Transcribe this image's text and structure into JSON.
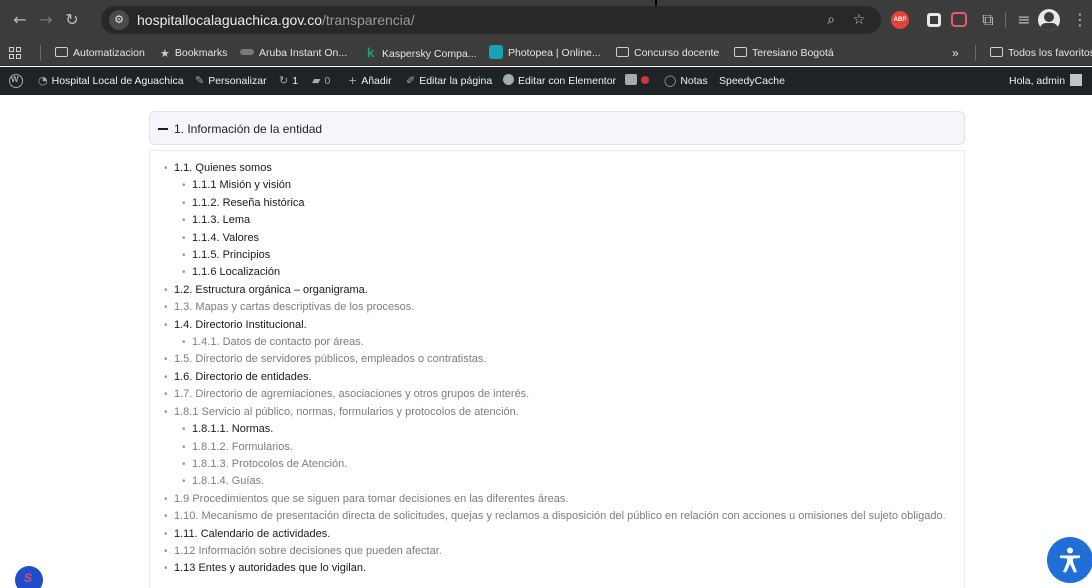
{
  "browser": {
    "url_host": "hospitallocalaguachica.gov.co",
    "url_path": "/transparencia/",
    "nav_icons": [
      "back-arrow-icon",
      "forward-arrow-icon",
      "reload-icon"
    ],
    "extension_abp_label": "ABP"
  },
  "bookmarks": {
    "items": [
      {
        "label": "Automatizacion",
        "icon": "folder-icon"
      },
      {
        "label": "Bookmarks",
        "icon": "star-icon"
      },
      {
        "label": "Aruba Instant On...",
        "icon": "aruba-icon"
      },
      {
        "label": "Kaspersky Compa...",
        "icon": "kaspersky-icon"
      },
      {
        "label": "Photopea | Online...",
        "icon": "photopea-icon"
      },
      {
        "label": "Concurso docente",
        "icon": "folder-icon"
      },
      {
        "label": "Teresiano Bogotá",
        "icon": "folder-icon"
      }
    ],
    "overflow": "»",
    "all_bookmarks": "Todos los favoritos"
  },
  "admin_bar": {
    "site_name": "Hospital Local de Aguachica",
    "customize": "Personalizar",
    "updates_count": "1",
    "comments_count": "0",
    "add_new": "Añadir",
    "edit_page": "Editar la página",
    "edit_elementor": "Editar con Elementor",
    "notes": "Notas",
    "speedycache": "SpeedyCache",
    "greeting": "Hola, admin"
  },
  "accordion": {
    "title": "1. Información de la entidad",
    "items": [
      {
        "text": "1.1. Quienes somos",
        "level": 1,
        "style": "dark"
      },
      {
        "text": "1.1.1 Misión y visión",
        "level": 2,
        "style": "dark"
      },
      {
        "text": "1.1.2. Reseña histórica",
        "level": 2,
        "style": "dark"
      },
      {
        "text": "1.1.3. Lema",
        "level": 2,
        "style": "dark"
      },
      {
        "text": "1.1.4. Valores",
        "level": 2,
        "style": "dark"
      },
      {
        "text": "1.1.5. Principios",
        "level": 2,
        "style": "dark"
      },
      {
        "text": "1.1.6 Localización",
        "level": 2,
        "style": "dark"
      },
      {
        "text": "1.2. Estructura orgánica – organigrama.",
        "level": 1,
        "style": "dark"
      },
      {
        "text": "1.3. Mapas y cartas descriptivas de los procesos.",
        "level": 1,
        "style": "grey"
      },
      {
        "text": "1.4. Directorio Institucional.",
        "level": 1,
        "style": "dark"
      },
      {
        "text": "1.4.1. Datos de contacto por áreas.",
        "level": 2,
        "style": "grey"
      },
      {
        "text": "1.5. Directorio de servidores públicos, empleados o contratistas.",
        "level": 1,
        "style": "grey"
      },
      {
        "text": "1.6. Directorio de entidades.",
        "level": 1,
        "style": "dark"
      },
      {
        "text": "1.7. Directorio de agremiaciones, asociaciones y otros grupos de interés.",
        "level": 1,
        "style": "grey"
      },
      {
        "text": "1.8.1 Servicio al público, normas, formularios y protocolos de atención.",
        "level": 1,
        "style": "grey"
      },
      {
        "text": "1.8.1.1. Normas.",
        "level": 2,
        "style": "dark"
      },
      {
        "text": "1.8.1.2. Formularios.",
        "level": 2,
        "style": "grey"
      },
      {
        "text": "1.8.1.3. Protocolos de Atención.",
        "level": 2,
        "style": "grey"
      },
      {
        "text": "1.8.1.4. Guías.",
        "level": 2,
        "style": "grey"
      },
      {
        "text": "1.9 Procedimientos que se siguen para tomar decisiones en las diferentes áreas.",
        "level": 1,
        "style": "grey"
      },
      {
        "text": "1.10. Mecanismo de presentación directa de solicitudes, quejas y reclamos a disposición del público en relación con acciones u omisiones del sujeto obligado.",
        "level": 1,
        "style": "grey"
      },
      {
        "text": "1.11. Calendario de actividades.",
        "level": 1,
        "style": "dark"
      },
      {
        "text": "1.12 Información sobre decisiones que pueden afectar.",
        "level": 1,
        "style": "grey"
      },
      {
        "text": "1.13 Entes y autoridades que lo vigilan.",
        "level": 1,
        "style": "dark"
      }
    ]
  },
  "colors": {
    "toolbar_bg": "#3c3c3c",
    "adminbar_bg": "#1d2327",
    "accordion_header_bg": "#f6f5fb",
    "accessibility_button": "#1f6fd6"
  }
}
